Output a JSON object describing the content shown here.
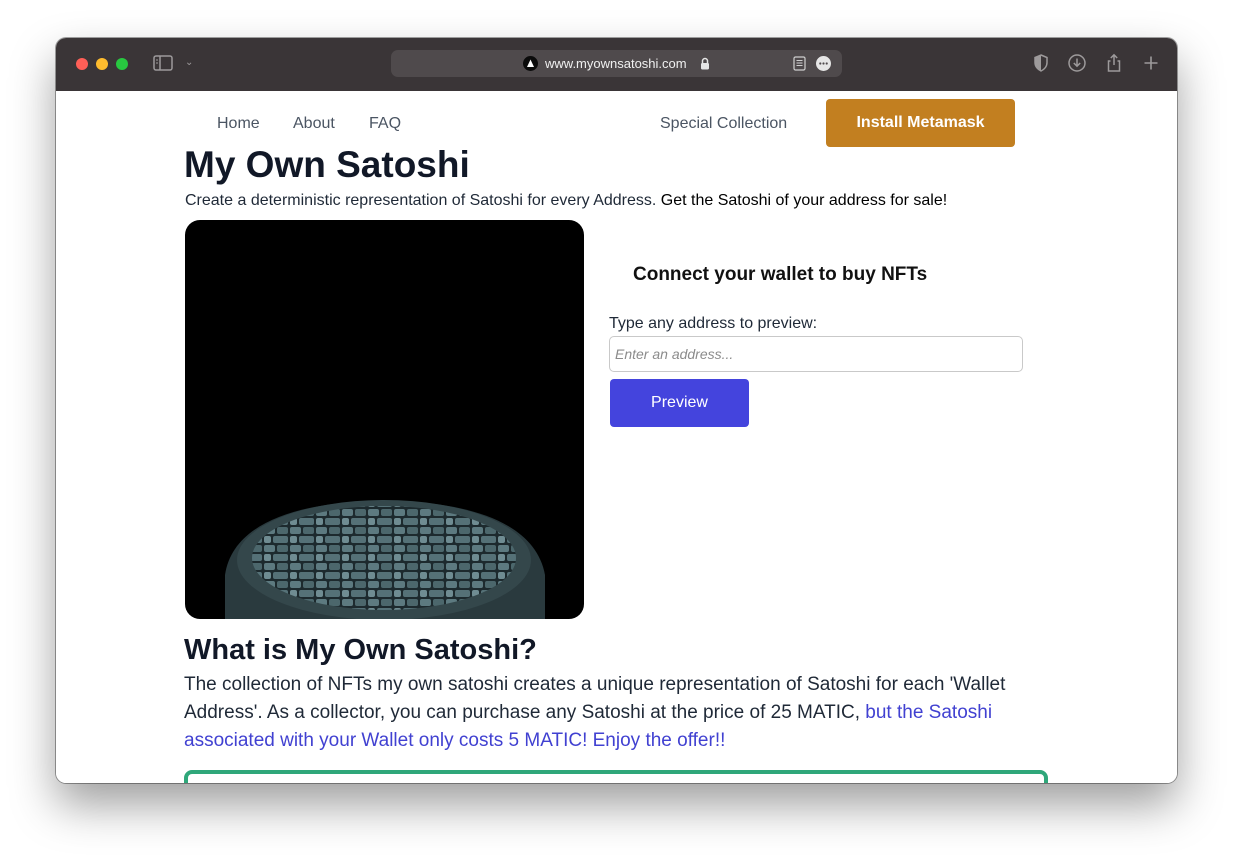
{
  "browser": {
    "url": "www.myownsatoshi.com"
  },
  "nav": {
    "home": "Home",
    "about": "About",
    "faq": "FAQ",
    "special": "Special Collection",
    "install": "Install Metamask"
  },
  "hero": {
    "title": "My Own Satoshi",
    "subtitle_plain": "Create a deterministic representation of Satoshi for every Address. ",
    "subtitle_strong": "Get the Satoshi of your address for sale!"
  },
  "wallet": {
    "connect": "Connect your wallet to buy NFTs",
    "label": "Type any address to preview:",
    "placeholder": "Enter an address...",
    "preview_button": "Preview"
  },
  "about": {
    "title": "What is My Own Satoshi?",
    "text_plain": "The collection of NFTs my own satoshi creates a unique representation of Satoshi for each 'Wallet Address'. As a collector, you can purchase any Satoshi at the price of 25 MATIC, ",
    "text_highlight": "but the Satoshi associated with your Wallet only costs 5 MATIC! Enjoy the offer!!"
  },
  "colors": {
    "accent": "#4444dd",
    "install": "#c27f20",
    "card_border": "#2fa77a"
  }
}
